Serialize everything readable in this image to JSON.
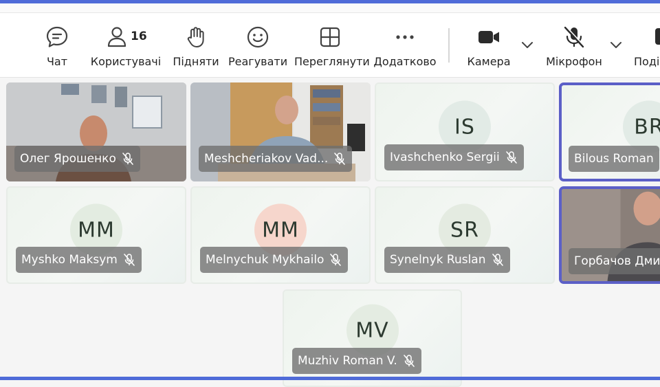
{
  "toolbar": {
    "chat_label": "Чат",
    "people_label": "Користувачі",
    "people_count": "16",
    "raise_label": "Підняти",
    "react_label": "Реагувати",
    "view_label": "Переглянути",
    "more_label": "Додатково",
    "camera_label": "Камера",
    "mic_label": "Мікрофон",
    "share_label": "Поді"
  },
  "tiles": [
    {
      "name": "Олег Ярошенко",
      "kind": "video"
    },
    {
      "name": "Meshcheriakov Vad...",
      "kind": "video"
    },
    {
      "name": "Ivashchenko Sergii",
      "initials": "IS",
      "avatar_color": "#e2ebe6"
    },
    {
      "name": "Bilous Roman",
      "initials": "BR",
      "avatar_color": "#e2ebe6"
    },
    {
      "name": "Myshko Maksym",
      "initials": "MM",
      "avatar_color": "#e3ece1"
    },
    {
      "name": "Melnychuk Mykhailo",
      "initials": "MM",
      "avatar_color": "#f6d6cc"
    },
    {
      "name": "Synelnyk Ruslan",
      "initials": "SR",
      "avatar_color": "#e4ebe1"
    },
    {
      "name": "Горбачов Дми",
      "kind": "video"
    },
    {
      "name": "Muzhiv Roman V.",
      "initials": "MV",
      "avatar_color": "#e4ece2"
    }
  ],
  "colors": {
    "accent": "#5b5fc7",
    "frame": "#4f6bd8",
    "badge": "#6e6e6e"
  }
}
